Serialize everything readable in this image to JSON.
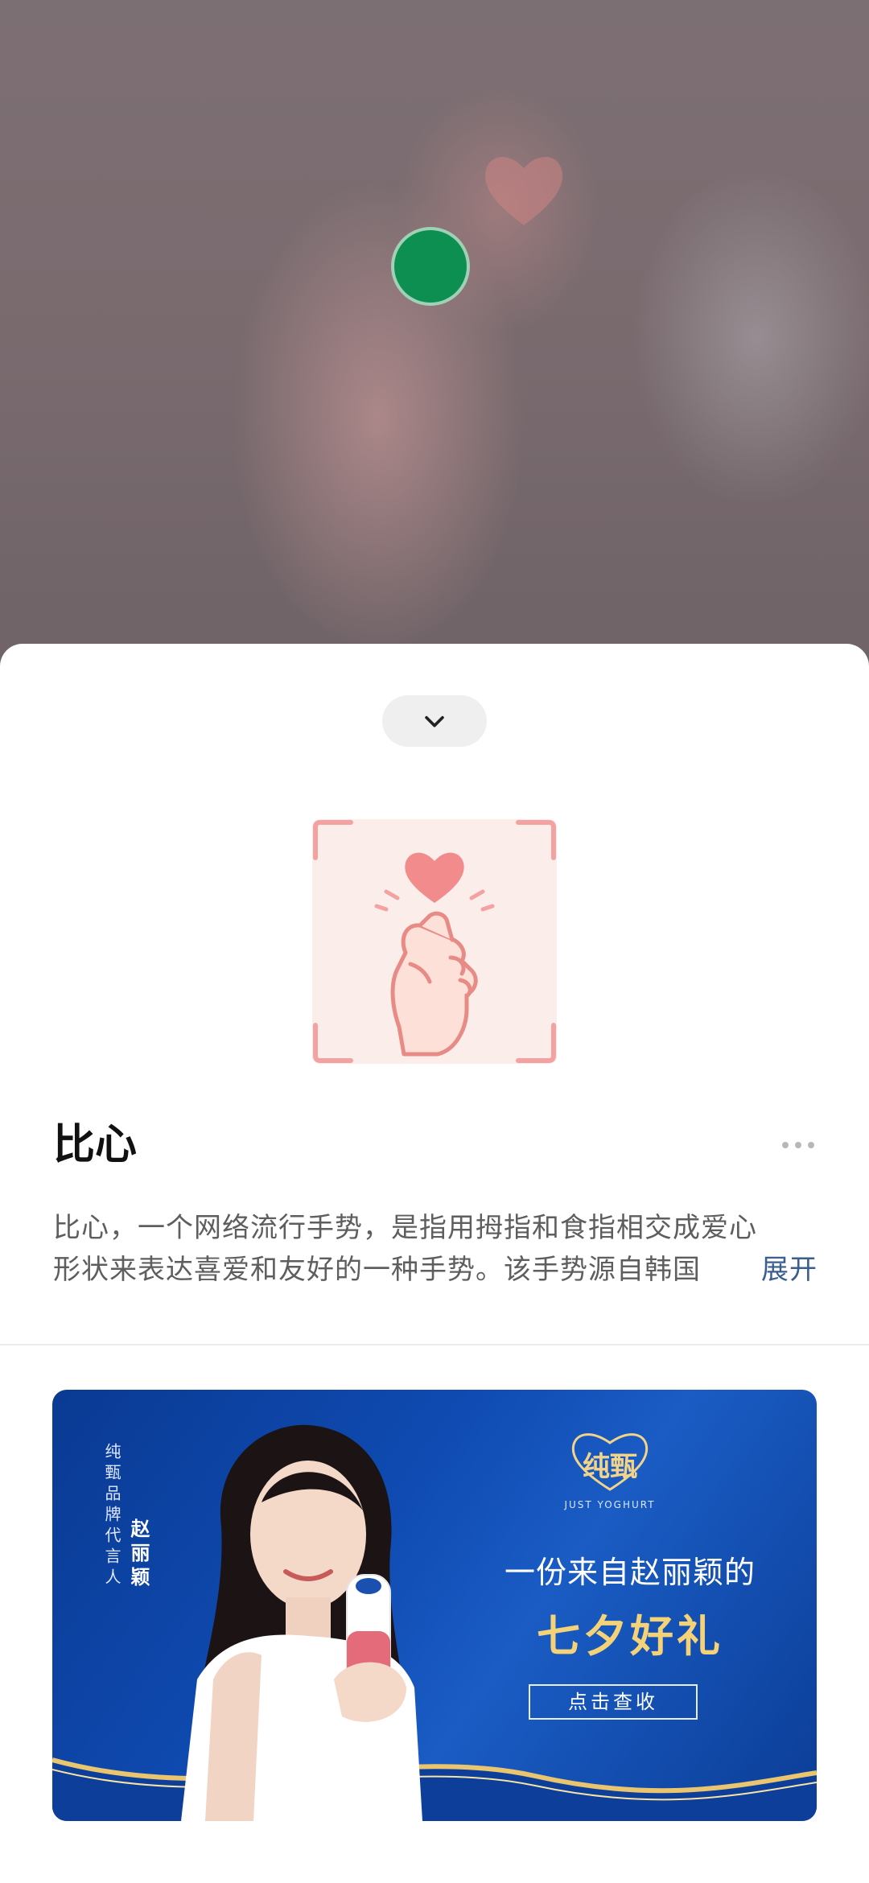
{
  "gesture": {
    "title": "比心",
    "description_line1": "比心，一个网络流行手势，是指用拇指和食指相交成爱心",
    "description_line2": "形状来表达喜爱和友好的一种手势。该手势源自韩国",
    "expand_label": "展开"
  },
  "ad": {
    "spokesperson_caption": "纯甄品牌代言人",
    "spokesperson_name": "赵丽颖",
    "brand_logo": "纯甄",
    "brand_sub": "JUST YOGHURT",
    "headline_line1": "一份来自赵丽颖的",
    "headline_line2": "七夕好礼",
    "cta_label": "点击查收"
  },
  "colors": {
    "accent_link": "#3a5f8f",
    "detect_dot": "#0d8f52",
    "gesture_pink": "#f4a1a1",
    "ad_blue": "#0f4bb2",
    "ad_gold": "#f3d278"
  }
}
